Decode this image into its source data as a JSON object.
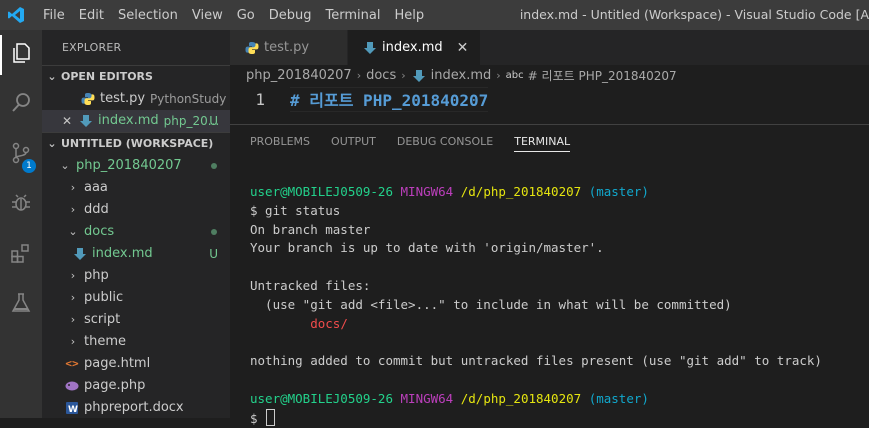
{
  "menu": [
    "File",
    "Edit",
    "Selection",
    "View",
    "Go",
    "Debug",
    "Terminal",
    "Help"
  ],
  "window_title": "index.md - Untitled (Workspace) - Visual Studio Code [A",
  "activity_badge": "1",
  "explorer": {
    "title": "EXPLORER",
    "open_editors_header": "OPEN EDITORS",
    "open_editors": [
      {
        "name": "test.py",
        "desc": "PythonStudy"
      },
      {
        "name": "index.md",
        "desc": "php_20...",
        "status": "U"
      }
    ],
    "workspace_header": "UNTITLED (WORKSPACE)",
    "root": "php_201840207",
    "tree": [
      {
        "name": "aaa"
      },
      {
        "name": "ddd"
      },
      {
        "name": "docs"
      },
      {
        "name": "index.md",
        "status": "U"
      },
      {
        "name": "php"
      },
      {
        "name": "public"
      },
      {
        "name": "script"
      },
      {
        "name": "theme"
      },
      {
        "name": "page.html"
      },
      {
        "name": "page.php"
      },
      {
        "name": "phpreport.docx"
      }
    ]
  },
  "tabs": [
    {
      "label": "test.py"
    },
    {
      "label": "index.md",
      "close": "✕"
    }
  ],
  "breadcrumb": {
    "folder": "php_201840207",
    "sub": "docs",
    "file": "index.md",
    "symbol_prefix": "abc",
    "symbol": "# 리포트 PHP_201840207"
  },
  "editor": {
    "line_number": "1",
    "line_text": "# 리포트 PHP_201840207"
  },
  "panel_tabs": [
    "PROBLEMS",
    "OUTPUT",
    "DEBUG CONSOLE",
    "TERMINAL"
  ],
  "terminal": {
    "prompt_user": "user@MOBILEJ0509-26",
    "prompt_env": "MINGW64",
    "prompt_path": "/d/php_201840207",
    "prompt_branch": "(master)",
    "cmd": "$ git status",
    "out1": "On branch master",
    "out2": "Your branch is up to date with 'origin/master'.",
    "out3": "Untracked files:",
    "out4": "  (use \"git add <file>...\" to include in what will be committed)",
    "out5": "docs/",
    "out6": "nothing added to commit but untracked files present (use \"git add\" to track)",
    "final_prompt": "$"
  }
}
